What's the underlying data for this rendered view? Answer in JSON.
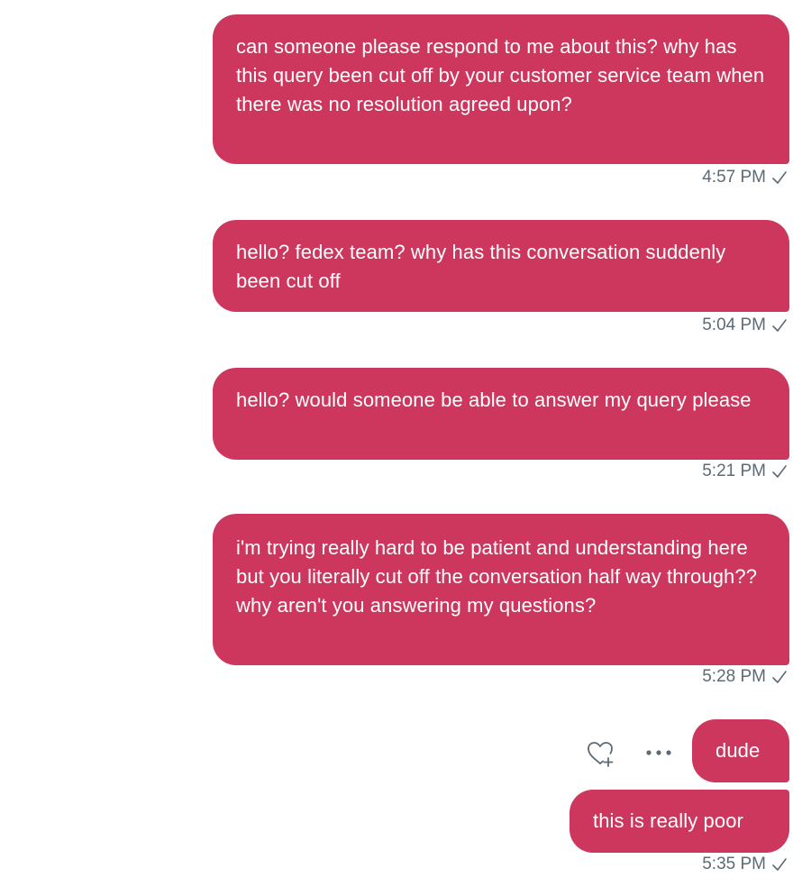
{
  "colors": {
    "bubble_bg": "#cd365d",
    "bubble_text": "#ffffff",
    "timestamp_text": "#5b6a76",
    "icon_color": "#5b6a76"
  },
  "messages": [
    {
      "text": "can someone please respond to me about this? why has this query been cut off by your customer service team when there was no resolution agreed upon?",
      "time": "4:57 PM"
    },
    {
      "text": "hello? fedex team? why has this conversation suddenly been cut off",
      "time": "5:04 PM"
    },
    {
      "text": "hello? would someone be able to answer my query please",
      "time": "5:21 PM"
    },
    {
      "text": "i'm trying really hard to be patient and understanding here but you literally cut off the conversation half way through?? why aren't you answering my questions?",
      "time": "5:28 PM"
    },
    {
      "text": "dude",
      "time": ""
    },
    {
      "text": "this is really poor",
      "time": "5:35 PM"
    }
  ],
  "actions": {
    "like_icon": "heart-plus-icon",
    "more_icon": "more-options-icon"
  }
}
